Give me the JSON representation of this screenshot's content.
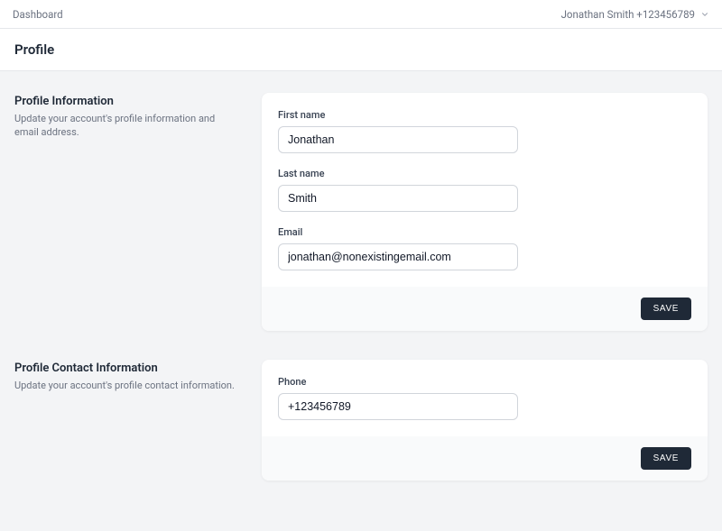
{
  "header": {
    "nav_link": "Dashboard",
    "user_display": "Jonathan Smith +123456789"
  },
  "page": {
    "title": "Profile"
  },
  "profile_info": {
    "title": "Profile Information",
    "description": "Update your account's profile information and email address.",
    "first_name_label": "First name",
    "first_name_value": "Jonathan",
    "last_name_label": "Last name",
    "last_name_value": "Smith",
    "email_label": "Email",
    "email_value": "jonathan@nonexistingemail.com",
    "save_label": "SAVE"
  },
  "contact_info": {
    "title": "Profile Contact Information",
    "description": "Update your account's profile contact information.",
    "phone_label": "Phone",
    "phone_value": "+123456789",
    "save_label": "SAVE"
  }
}
